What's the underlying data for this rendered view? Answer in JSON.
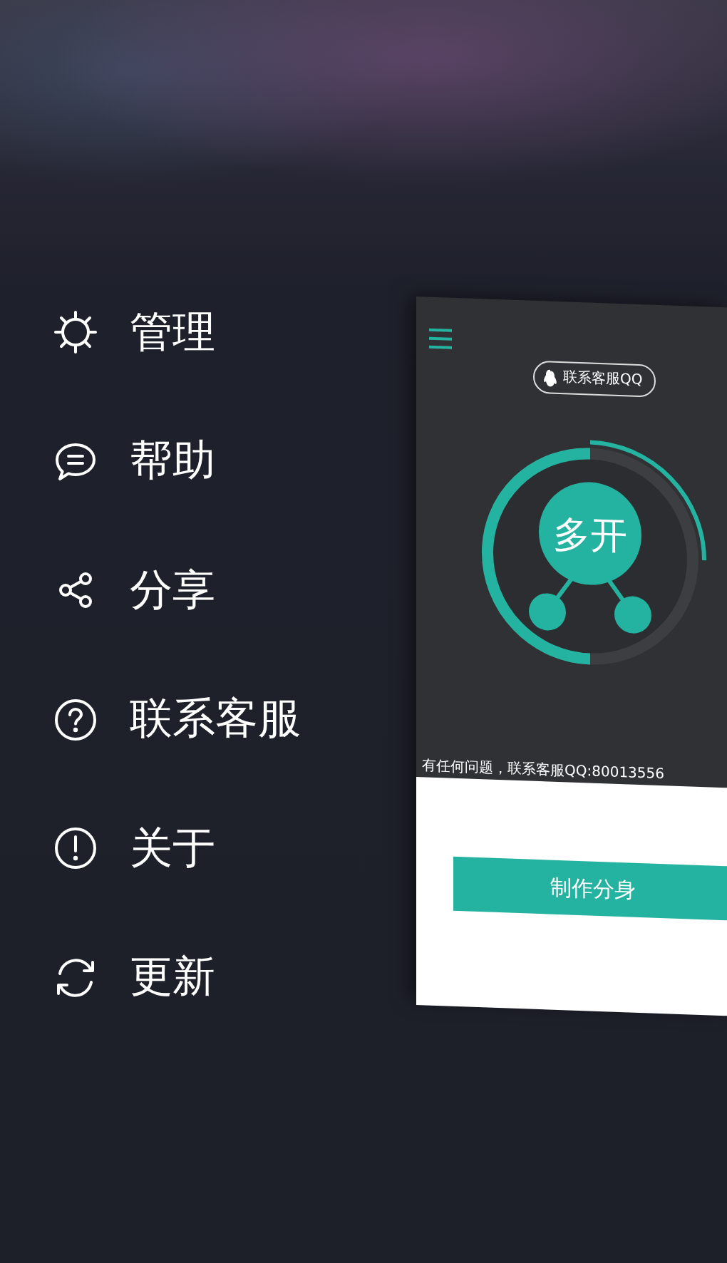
{
  "menu": [
    {
      "label": "管理"
    },
    {
      "label": "帮助"
    },
    {
      "label": "分享"
    },
    {
      "label": "联系客服"
    },
    {
      "label": "关于"
    },
    {
      "label": "更新"
    }
  ],
  "preview": {
    "qq_button": "联系客服QQ",
    "logo_label": "多开",
    "notice": "有任何问题，联系客服QQ:80013556",
    "primary_button": "制作分身"
  }
}
